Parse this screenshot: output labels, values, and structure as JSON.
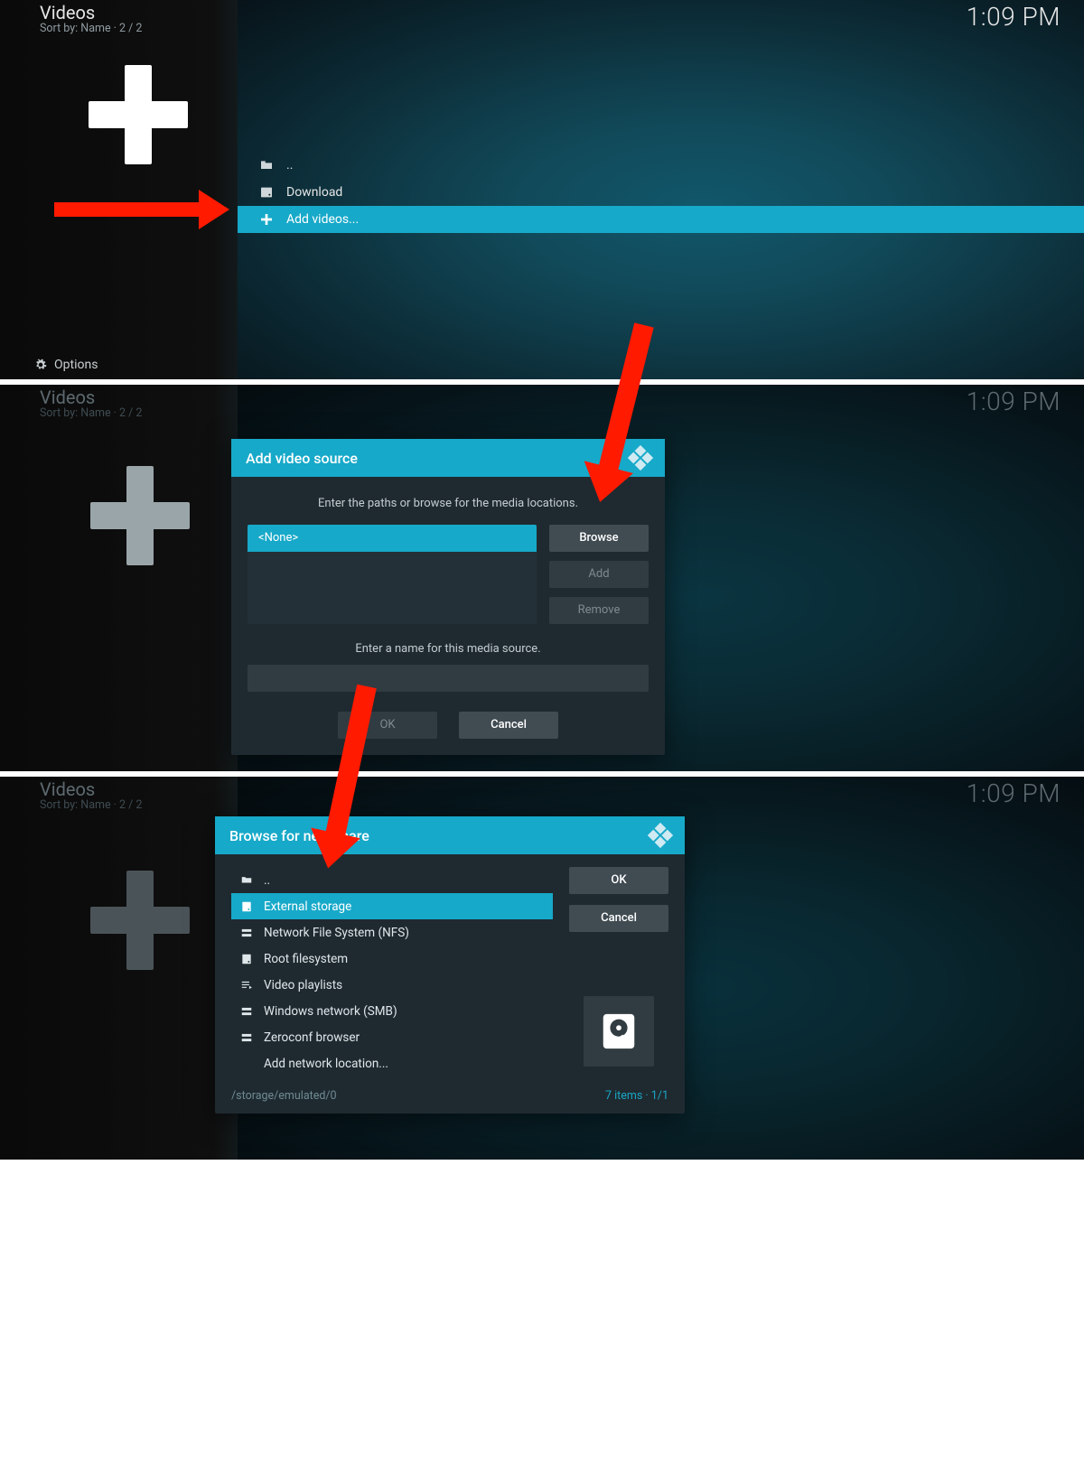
{
  "common": {
    "title": "Videos",
    "subtitle": "Sort by: Name  ·  2 / 2",
    "time": "1:09 PM",
    "options": "Options"
  },
  "panel1": {
    "rows": {
      "up": "..",
      "download": "Download",
      "add": "Add videos..."
    }
  },
  "panel2": {
    "dialog_title": "Add video source",
    "msg1": "Enter the paths or browse for the media locations.",
    "none": "<None>",
    "browse": "Browse",
    "add": "Add",
    "remove": "Remove",
    "msg2": "Enter a name for this media source.",
    "ok": "OK",
    "cancel": "Cancel"
  },
  "panel3": {
    "dialog_title": "Browse for new share",
    "rows": {
      "up": "..",
      "ext": "External storage",
      "nfs": "Network File System (NFS)",
      "root": "Root filesystem",
      "vpl": "Video playlists",
      "smb": "Windows network (SMB)",
      "zc": "Zeroconf browser",
      "addnet": "Add network location..."
    },
    "ok": "OK",
    "cancel": "Cancel",
    "status_path": "/storage/emulated/0",
    "status_items": "7 items · 1/1"
  }
}
